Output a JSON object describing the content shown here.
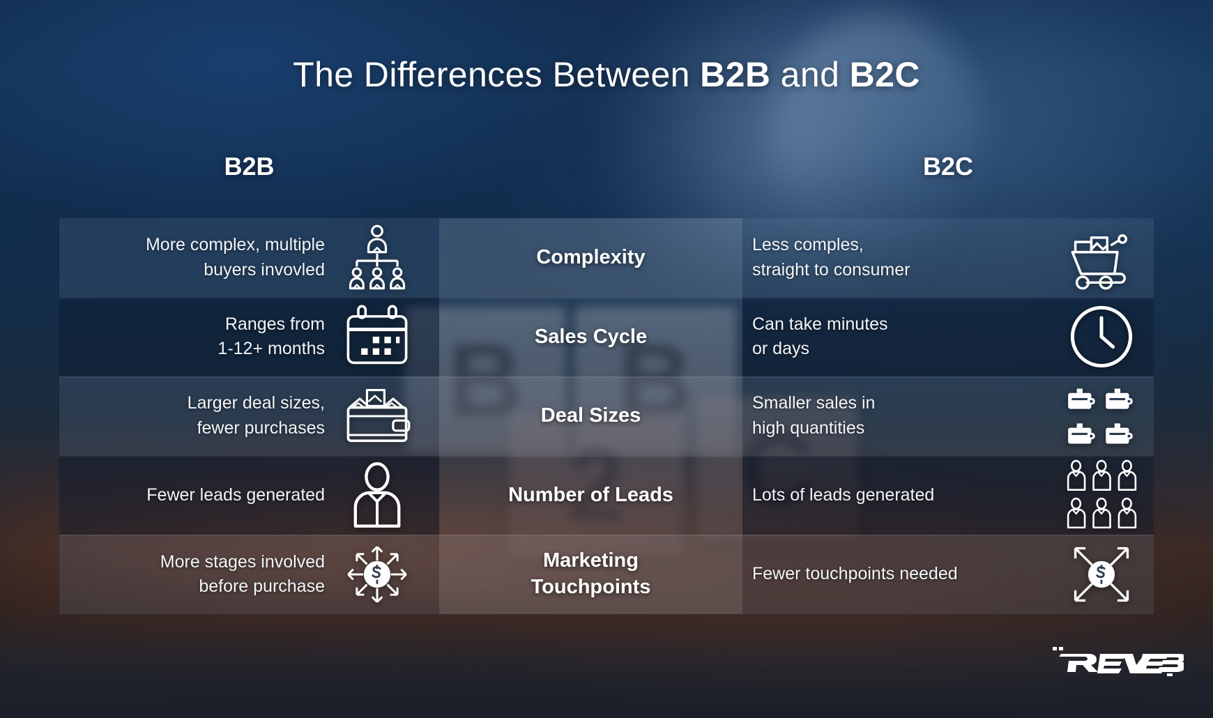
{
  "title": {
    "prefix": "The Differences Between ",
    "bold_1": "B2B",
    "middle": " and ",
    "bold_2": "B2C"
  },
  "columns": {
    "left_header": "B2B",
    "right_header": "B2C"
  },
  "colors": {
    "background_top": "#133156",
    "background_bottom": "#1a1f28",
    "text": "#f2f5f8",
    "accent": "#ffffff",
    "row_light": "rgba(126,150,175,0.17)",
    "row_dark": "rgba(10,24,46,0.40)"
  },
  "rows": [
    {
      "label": "Complexity",
      "b2b_text": "More complex, multiple\nbuyers invovled",
      "b2b_icon": "org-chart-people-icon",
      "b2c_text": "Less comples,\nstraight to consumer",
      "b2c_icon": "shopping-cart-icon"
    },
    {
      "label": "Sales Cycle",
      "b2b_text": "Ranges from\n1-12+ months",
      "b2b_icon": "calendar-icon",
      "b2c_text": "Can take minutes\nor days",
      "b2c_icon": "clock-icon"
    },
    {
      "label": "Deal Sizes",
      "b2b_text": "Larger deal sizes,\nfewer purchases",
      "b2b_icon": "wallet-full-of-money-icon",
      "b2c_text": "Smaller sales in\nhigh quantities",
      "b2c_icon": "four-wallets-icon"
    },
    {
      "label": "Number of Leads",
      "b2b_text": "Fewer leads generated",
      "b2b_icon": "single-person-icon",
      "b2c_text": "Lots of leads generated",
      "b2c_icon": "six-people-icon"
    },
    {
      "label": "Marketing\nTouchpoints",
      "b2b_text": "More stages involved\nbefore purchase",
      "b2b_icon": "dollar-arrows-outward-icon",
      "b2c_text": "Fewer touchpoints needed",
      "b2c_icon": "dollar-arrows-x-icon"
    }
  ],
  "branding": {
    "logo_text": "REVERB"
  },
  "background": {
    "key_1": "B",
    "key_2": "B",
    "key_3": "2",
    "key_4": "C"
  }
}
